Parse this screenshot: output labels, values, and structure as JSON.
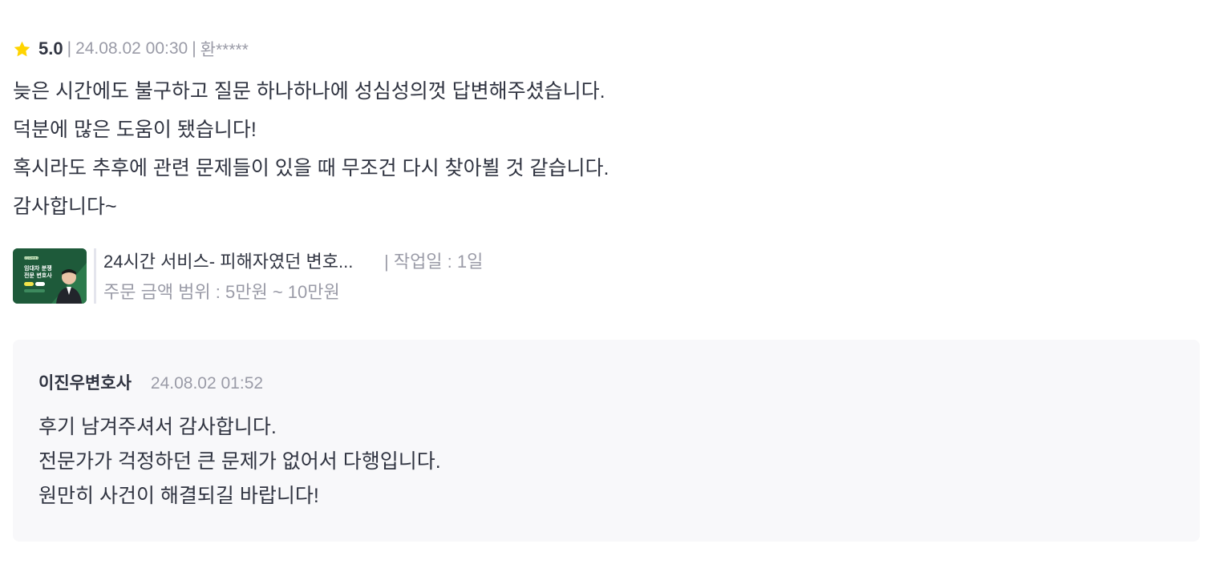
{
  "review": {
    "rating": "5.0",
    "date": "24.08.02 00:30",
    "author": "환*****",
    "separator": "|",
    "lines": [
      "늦은 시간에도 불구하고 질문 하나하나에 성심성의껏 답변해주셨습니다.",
      "덕분에 많은 도움이 됐습니다!",
      "혹시라도 추후에 관련 문제들이 있을 때 무조건 다시 찾아뵐 것 같습니다.",
      "감사합니다~"
    ],
    "star_color": "#FFD400"
  },
  "service": {
    "title": "24시간 서비스- 피해자였던 변호...",
    "work_days": "| 작업일 : 1일",
    "price_range": "주문 금액 범위 : 5만원 ~ 10만원",
    "thumbnail": {
      "tag": "이진우변호사",
      "line1": "임대차 분쟁",
      "line2": "전문 변호사",
      "bg_color": "#1E5A3A"
    }
  },
  "reply": {
    "author": "이진우변호사",
    "date": "24.08.02 01:52",
    "lines": [
      "후기 남겨주셔서 감사합니다.",
      "전문가가 걱정하던 큰 문제가 없어서 다행입니다.",
      "원만히 사건이 해결되길 바랍니다!"
    ]
  }
}
